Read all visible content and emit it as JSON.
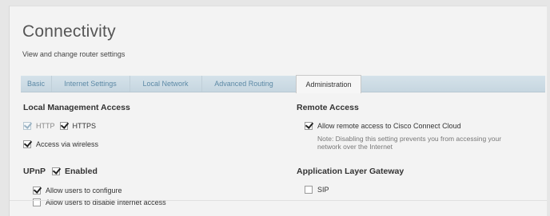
{
  "page": {
    "title": "Connectivity",
    "subtitle": "View and change router settings"
  },
  "tabs": [
    {
      "label": "Basic",
      "active": false
    },
    {
      "label": "Internet Settings",
      "active": false
    },
    {
      "label": "Local Network",
      "active": false
    },
    {
      "label": "Advanced Routing",
      "active": false
    },
    {
      "label": "Administration",
      "active": true
    }
  ],
  "local_management": {
    "heading": "Local Management Access",
    "http": {
      "label": "HTTP",
      "checked": true,
      "disabled": true
    },
    "https": {
      "label": "HTTPS",
      "checked": true
    },
    "wireless": {
      "label": "Access via wireless",
      "checked": true
    }
  },
  "upnp": {
    "heading": "UPnP",
    "enabled": {
      "label": "Enabled",
      "checked": true
    },
    "allow_configure": {
      "label": "Allow users to configure",
      "checked": true
    },
    "allow_disable": {
      "label": "Allow users to disable Internet access",
      "checked": false
    }
  },
  "remote_access": {
    "heading": "Remote Access",
    "allow": {
      "label": "Allow remote access to Cisco Connect Cloud",
      "checked": true
    },
    "note_line1": "Note: Disabling this setting prevents you from accessing your",
    "note_line2": "network over the Internet"
  },
  "alg": {
    "heading": "Application Layer Gateway",
    "sip": {
      "label": "SIP",
      "checked": false
    }
  },
  "colors": {
    "tab_text": "#5d8aa6",
    "tabbar": "#c6d6e0",
    "panel": "#f3f3f3"
  }
}
